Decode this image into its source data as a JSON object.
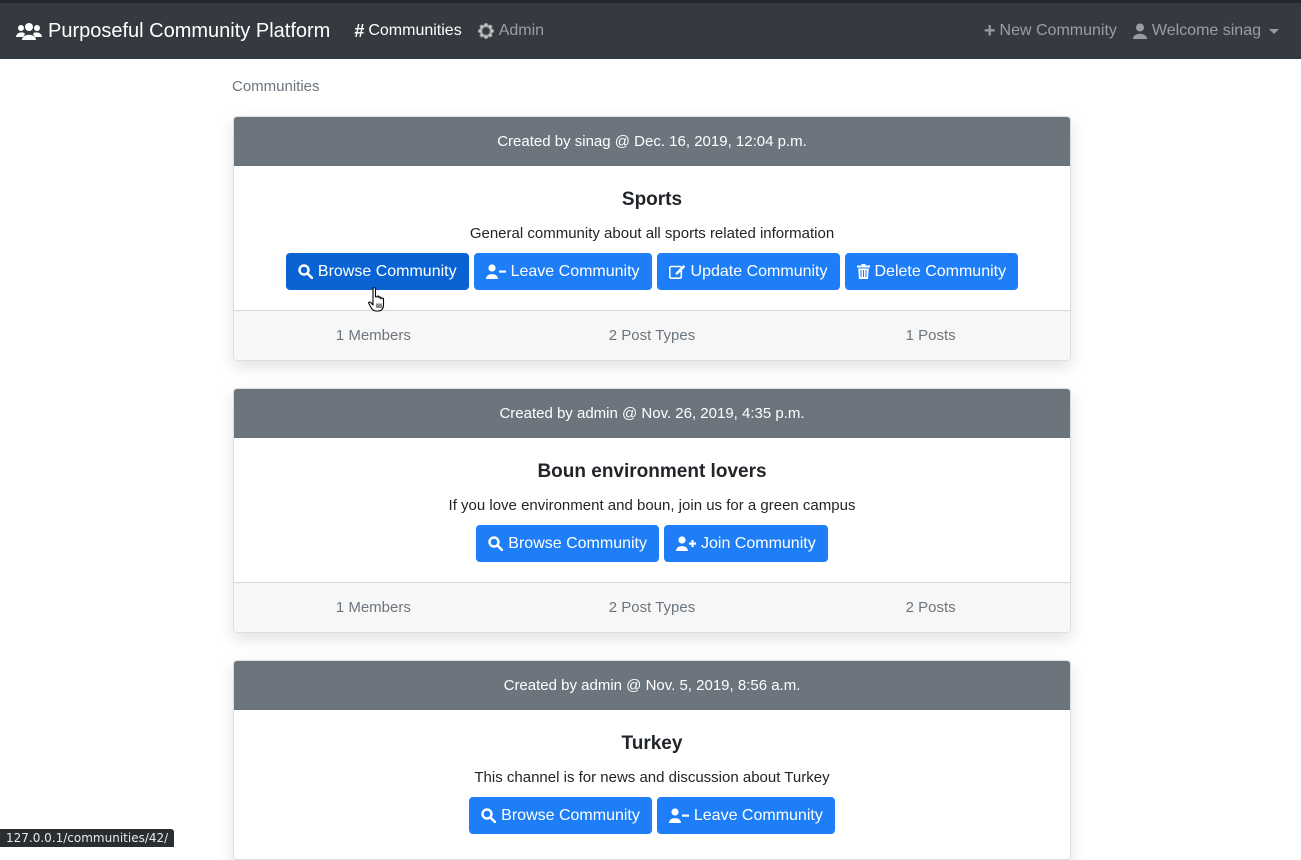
{
  "navbar": {
    "brand": "Purposeful Community Platform",
    "brand_icon": "users-icon",
    "links": [
      {
        "label": "Communities",
        "icon": "hashtag-icon",
        "active": true
      },
      {
        "label": "Admin",
        "icon": "cog-icon",
        "active": false
      }
    ],
    "new_community": "New Community",
    "welcome": "Welcome sinag"
  },
  "breadcrumb": "Communities",
  "communities": [
    {
      "header": "Created by sinag @ Dec. 16, 2019, 12:04 p.m.",
      "title": "Sports",
      "description": "General community about all sports related information",
      "buttons": {
        "browse": "Browse Community",
        "leave": "Leave Community",
        "update": "Update Community",
        "delete": "Delete Community"
      },
      "members": "1 Members",
      "post_types": "2 Post Types",
      "posts": "1 Posts"
    },
    {
      "header": "Created by admin @ Nov. 26, 2019, 4:35 p.m.",
      "title": "Boun environment lovers",
      "description": "If you love environment and boun, join us for a green campus",
      "buttons": {
        "browse": "Browse Community",
        "join": "Join Community"
      },
      "members": "1 Members",
      "post_types": "2 Post Types",
      "posts": "2 Posts"
    },
    {
      "header": "Created by admin @ Nov. 5, 2019, 8:56 a.m.",
      "title": "Turkey",
      "description": "This channel is for news and discussion about Turkey",
      "buttons": {
        "browse": "Browse Community",
        "leave": "Leave Community"
      }
    }
  ],
  "status_url": "127.0.0.1/communities/42/",
  "colors": {
    "navbar": "#343a40",
    "card_header": "#6c757d",
    "primary": "#1e7ef7",
    "primary_hover": "#0a63d3"
  }
}
